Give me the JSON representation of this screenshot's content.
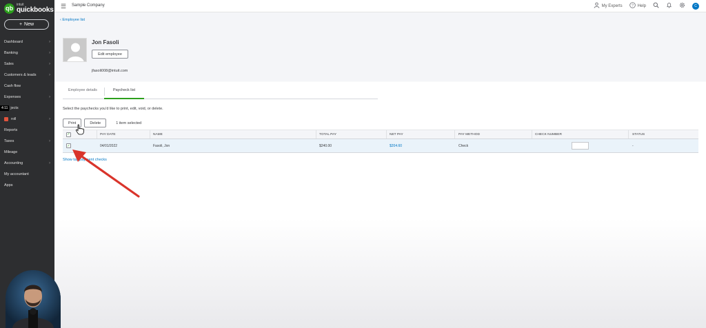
{
  "app": {
    "brand_small": "intuit",
    "brand_name": "quickbooks",
    "company": "Sample Company"
  },
  "sidebar": {
    "new_label": "New",
    "items": [
      {
        "label": "Dashboard",
        "has_chevron": true
      },
      {
        "label": "Banking",
        "has_chevron": true
      },
      {
        "label": "Sales",
        "has_chevron": true
      },
      {
        "label": "Customers & leads",
        "has_chevron": true
      },
      {
        "label": "Cash flow",
        "has_chevron": false
      },
      {
        "label": "Expenses",
        "has_chevron": true
      },
      {
        "label": "jects",
        "badge": "4:11",
        "has_chevron": false
      },
      {
        "label": "roll",
        "has_chevron": true
      },
      {
        "label": "Reports",
        "has_chevron": false
      },
      {
        "label": "Taxes",
        "has_chevron": true
      },
      {
        "label": "Mileage",
        "has_chevron": false
      },
      {
        "label": "Accounting",
        "has_chevron": true
      },
      {
        "label": "My accountant",
        "has_chevron": false
      },
      {
        "label": "Apps",
        "has_chevron": false
      }
    ]
  },
  "topbar": {
    "my_experts": "My Experts",
    "help": "Help",
    "avatar_initial": "C"
  },
  "page": {
    "back_link": "Employee list",
    "employee_name": "Jon Fasoli",
    "edit_button": "Edit employee",
    "email": "jfasoli008@intuit.com",
    "tabs": [
      "Employee details",
      "Paycheck list"
    ],
    "active_tab": "Paycheck list",
    "instructions": "Select the paychecks you'd like to print, edit, void, or delete.",
    "print_button": "Print",
    "delete_button": "Delete",
    "selected_count": "1 item selected",
    "show_link": "Show tax payment checks"
  },
  "table": {
    "columns": [
      "PAY DATE",
      "NAME",
      "TOTAL PAY",
      "NET PAY",
      "PAY METHOD",
      "CHECK NUMBER",
      "STATUS"
    ],
    "rows": [
      {
        "checked": true,
        "pay_date": "04/01/2022",
        "name": "Fasoli, Jon",
        "total_pay": "$240.00",
        "net_pay": "$204.60",
        "pay_method": "Check",
        "check_number": "",
        "status": "-"
      }
    ]
  },
  "colors": {
    "sidebar_bg": "#2d2e30",
    "brand_green": "#2ca01c",
    "link_blue": "#0077c5",
    "arrow_red": "#d9342b",
    "selected_row": "#eaf3fa"
  }
}
